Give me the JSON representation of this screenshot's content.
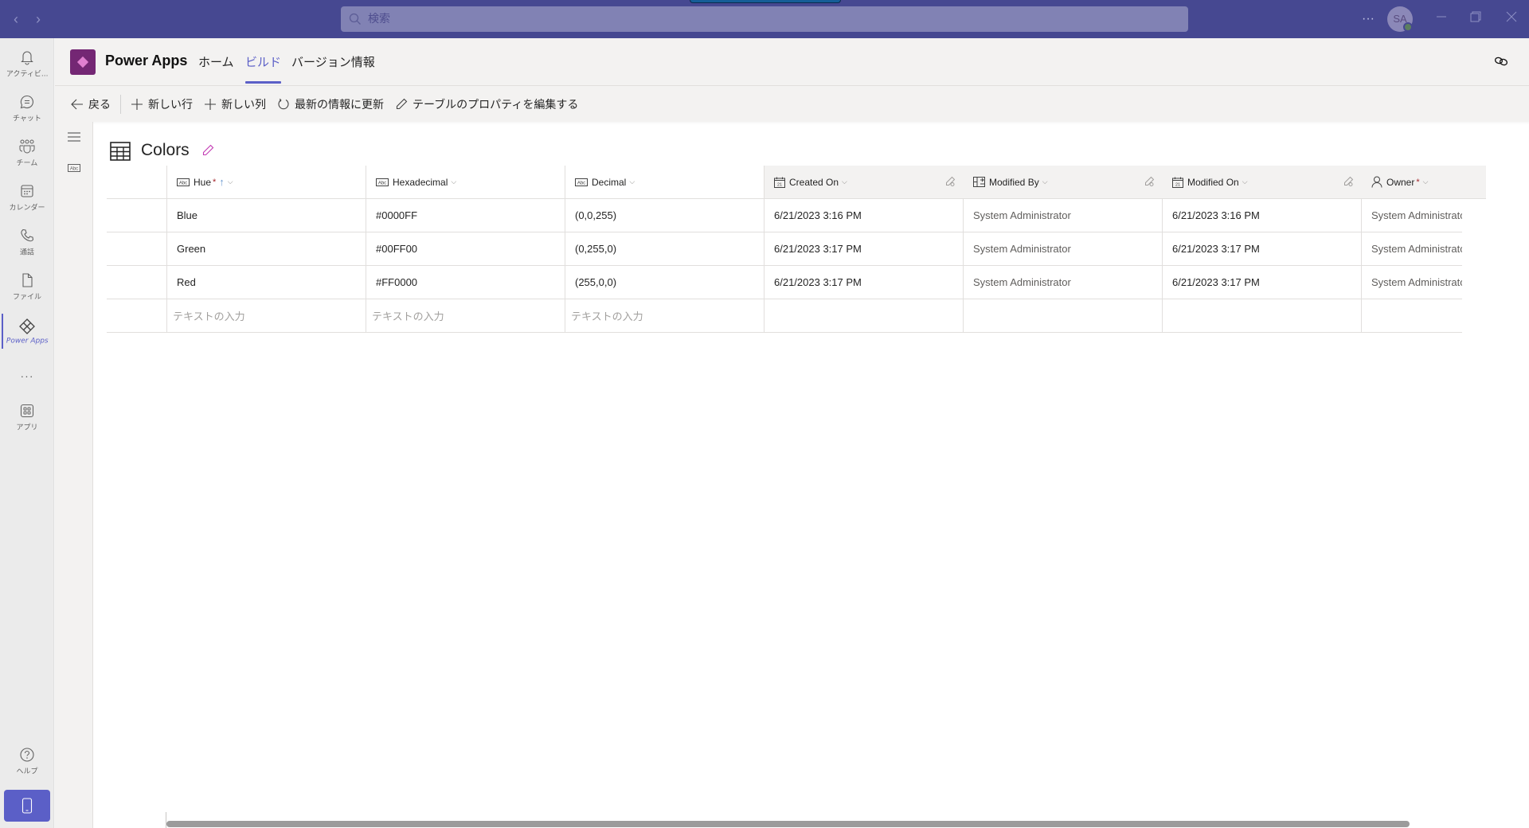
{
  "titlebar": {
    "back_icon": "chevron-left-icon",
    "forward_icon": "chevron-right-icon",
    "search_placeholder": "検索",
    "more_label": "···",
    "avatar_initials": "SA",
    "presence_status": "available"
  },
  "rail": {
    "items": [
      {
        "label": "アクティビ...",
        "icon": "bell-icon"
      },
      {
        "label": "チャット",
        "icon": "chat-icon"
      },
      {
        "label": "チーム",
        "icon": "teams-icon"
      },
      {
        "label": "カレンダー",
        "icon": "calendar-icon"
      },
      {
        "label": "通話",
        "icon": "phone-icon"
      },
      {
        "label": "ファイル",
        "icon": "file-icon"
      },
      {
        "label": "Power Apps",
        "icon": "power-apps-icon",
        "active": true
      },
      {
        "label": "···",
        "icon": "more-icon"
      },
      {
        "label": "アプリ",
        "icon": "apps-icon"
      },
      {
        "label": "ヘルプ",
        "icon": "help-icon"
      }
    ]
  },
  "app": {
    "name": "Power Apps",
    "tabs": [
      {
        "label": "ホーム"
      },
      {
        "label": "ビルド",
        "active": true
      },
      {
        "label": "バージョン情報"
      }
    ]
  },
  "toolbar": {
    "back": "戻る",
    "new_row": "新しい行",
    "new_column": "新しい列",
    "refresh": "最新の情報に更新",
    "edit_table_props": "テーブルのプロパティを編集する"
  },
  "table": {
    "title": "Colors",
    "columns": [
      {
        "name": "Hue",
        "type": "text",
        "required": true,
        "sorted": "asc",
        "readonly": false
      },
      {
        "name": "Hexadecimal",
        "type": "text",
        "required": false,
        "readonly": false
      },
      {
        "name": "Decimal",
        "type": "text",
        "required": false,
        "readonly": false
      },
      {
        "name": "Created On",
        "type": "date",
        "required": false,
        "readonly": true
      },
      {
        "name": "Modified By",
        "type": "lookup",
        "required": false,
        "readonly": true
      },
      {
        "name": "Modified On",
        "type": "date",
        "required": false,
        "readonly": true
      },
      {
        "name": "Owner",
        "type": "owner",
        "required": true,
        "readonly": true
      }
    ],
    "rows": [
      [
        "Blue",
        "#0000FF",
        "(0,0,255)",
        "6/21/2023 3:16 PM",
        "System Administrator",
        "6/21/2023 3:16 PM",
        "System Administrator"
      ],
      [
        "Green",
        "#00FF00",
        "(0,255,0)",
        "6/21/2023 3:17 PM",
        "System Administrator",
        "6/21/2023 3:17 PM",
        "System Administrator"
      ],
      [
        "Red",
        "#FF0000",
        "(255,0,0)",
        "6/21/2023 3:17 PM",
        "System Administrator",
        "6/21/2023 3:17 PM",
        "System Administrator"
      ]
    ],
    "new_row_placeholder": "テキストの入力",
    "required_marker": "*",
    "sort_marker": "↑",
    "chevron": "⌵"
  },
  "colors": {
    "titlebar": "#464891",
    "accent": "#5b5fc7",
    "brand": "#742774",
    "required": "#a4262c"
  }
}
